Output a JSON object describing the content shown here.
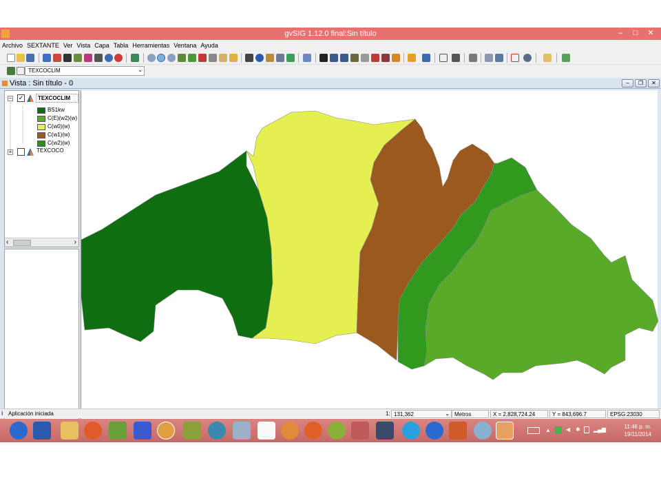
{
  "window": {
    "title": "gvSIG 1.12.0 final:Sin título",
    "minimize": "–",
    "maximize": "□",
    "close": "✕"
  },
  "menu": [
    "Archivo",
    "SEXTANTE",
    "Ver",
    "Vista",
    "Capa",
    "Tabla",
    "Herramientas",
    "Ventana",
    "Ayuda"
  ],
  "layer_selector": {
    "value": "TEXCOCLIM"
  },
  "view": {
    "title": "Vista : Sin título - 0"
  },
  "toc": {
    "layers": [
      {
        "name": "TEXCOCLIM",
        "checked": true,
        "expanded": true
      },
      {
        "name": "TEXCOCO",
        "checked": false,
        "expanded": false
      }
    ],
    "legend": [
      {
        "label": "BS1kw",
        "color": "#0f6e0f"
      },
      {
        "label": "C(E)(w2)(w)",
        "color": "#5aaa2a"
      },
      {
        "label": "C(w0)(w)",
        "color": "#e5f050"
      },
      {
        "label": "C(w1)(w)",
        "color": "#9a5a1e"
      },
      {
        "label": "C(w2)(w)",
        "color": "#2f8f1a"
      }
    ],
    "scroll_left": "‹",
    "scroll_right": "›"
  },
  "map_colors": {
    "bs1kw": "#0f6e0f",
    "cw0": "#e5f050",
    "cw1": "#9a5a1e",
    "cw2": "#2f9a1e",
    "cew2": "#5aaa2a"
  },
  "status": {
    "message": "Aplicación iniciada",
    "scale_prefix": "1:",
    "scale": "131,362",
    "units": "Metros",
    "x": "X = 2,828,724.24",
    "y": "Y = 843,696.7",
    "epsg": "EPSG:23030"
  },
  "clock": {
    "time": "11:46 p. m.",
    "date": "19/11/2014"
  }
}
